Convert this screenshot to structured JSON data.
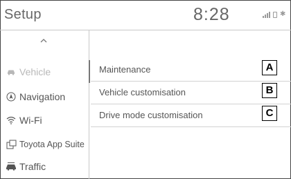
{
  "header": {
    "title": "Setup",
    "time": "8:28",
    "status_icons": [
      "signal-icon",
      "phone-icon",
      "bluetooth-icon"
    ]
  },
  "sidebar": {
    "items": [
      {
        "label": "Vehicle",
        "icon": "car-icon",
        "active": true
      },
      {
        "label": "Navigation",
        "icon": "navigation-icon"
      },
      {
        "label": "Wi-Fi",
        "icon": "wifi-icon"
      },
      {
        "label": "Toyota App Suite",
        "icon": "app-suite-icon"
      },
      {
        "label": "Traffic",
        "icon": "traffic-icon"
      }
    ]
  },
  "menu": {
    "items": [
      {
        "label": "Maintenance",
        "callout": "A"
      },
      {
        "label": "Vehicle customisation",
        "callout": "B"
      },
      {
        "label": "Drive mode customisation",
        "callout": "C"
      }
    ]
  },
  "colors": {
    "text": "#555555",
    "inactive_text": "#b8b8b8",
    "divider": "#c8c8c8",
    "frame": "#444444"
  }
}
